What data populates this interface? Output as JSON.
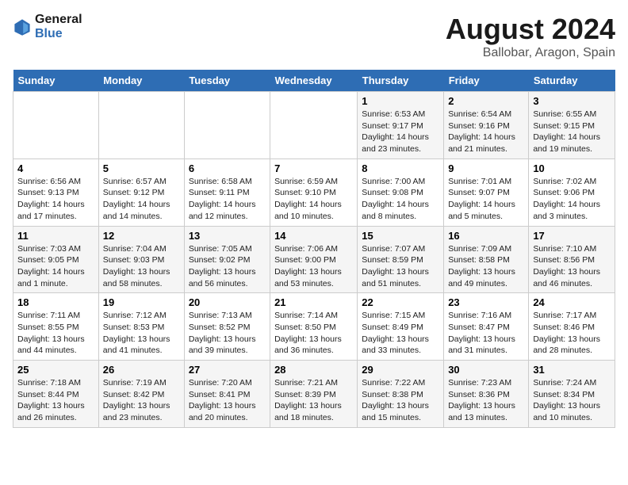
{
  "logo": {
    "line1": "General",
    "line2": "Blue"
  },
  "title": "August 2024",
  "subtitle": "Ballobar, Aragon, Spain",
  "days_of_week": [
    "Sunday",
    "Monday",
    "Tuesday",
    "Wednesday",
    "Thursday",
    "Friday",
    "Saturday"
  ],
  "weeks": [
    [
      {
        "num": "",
        "info": ""
      },
      {
        "num": "",
        "info": ""
      },
      {
        "num": "",
        "info": ""
      },
      {
        "num": "",
        "info": ""
      },
      {
        "num": "1",
        "info": "Sunrise: 6:53 AM\nSunset: 9:17 PM\nDaylight: 14 hours\nand 23 minutes."
      },
      {
        "num": "2",
        "info": "Sunrise: 6:54 AM\nSunset: 9:16 PM\nDaylight: 14 hours\nand 21 minutes."
      },
      {
        "num": "3",
        "info": "Sunrise: 6:55 AM\nSunset: 9:15 PM\nDaylight: 14 hours\nand 19 minutes."
      }
    ],
    [
      {
        "num": "4",
        "info": "Sunrise: 6:56 AM\nSunset: 9:13 PM\nDaylight: 14 hours\nand 17 minutes."
      },
      {
        "num": "5",
        "info": "Sunrise: 6:57 AM\nSunset: 9:12 PM\nDaylight: 14 hours\nand 14 minutes."
      },
      {
        "num": "6",
        "info": "Sunrise: 6:58 AM\nSunset: 9:11 PM\nDaylight: 14 hours\nand 12 minutes."
      },
      {
        "num": "7",
        "info": "Sunrise: 6:59 AM\nSunset: 9:10 PM\nDaylight: 14 hours\nand 10 minutes."
      },
      {
        "num": "8",
        "info": "Sunrise: 7:00 AM\nSunset: 9:08 PM\nDaylight: 14 hours\nand 8 minutes."
      },
      {
        "num": "9",
        "info": "Sunrise: 7:01 AM\nSunset: 9:07 PM\nDaylight: 14 hours\nand 5 minutes."
      },
      {
        "num": "10",
        "info": "Sunrise: 7:02 AM\nSunset: 9:06 PM\nDaylight: 14 hours\nand 3 minutes."
      }
    ],
    [
      {
        "num": "11",
        "info": "Sunrise: 7:03 AM\nSunset: 9:05 PM\nDaylight: 14 hours\nand 1 minute."
      },
      {
        "num": "12",
        "info": "Sunrise: 7:04 AM\nSunset: 9:03 PM\nDaylight: 13 hours\nand 58 minutes."
      },
      {
        "num": "13",
        "info": "Sunrise: 7:05 AM\nSunset: 9:02 PM\nDaylight: 13 hours\nand 56 minutes."
      },
      {
        "num": "14",
        "info": "Sunrise: 7:06 AM\nSunset: 9:00 PM\nDaylight: 13 hours\nand 53 minutes."
      },
      {
        "num": "15",
        "info": "Sunrise: 7:07 AM\nSunset: 8:59 PM\nDaylight: 13 hours\nand 51 minutes."
      },
      {
        "num": "16",
        "info": "Sunrise: 7:09 AM\nSunset: 8:58 PM\nDaylight: 13 hours\nand 49 minutes."
      },
      {
        "num": "17",
        "info": "Sunrise: 7:10 AM\nSunset: 8:56 PM\nDaylight: 13 hours\nand 46 minutes."
      }
    ],
    [
      {
        "num": "18",
        "info": "Sunrise: 7:11 AM\nSunset: 8:55 PM\nDaylight: 13 hours\nand 44 minutes."
      },
      {
        "num": "19",
        "info": "Sunrise: 7:12 AM\nSunset: 8:53 PM\nDaylight: 13 hours\nand 41 minutes."
      },
      {
        "num": "20",
        "info": "Sunrise: 7:13 AM\nSunset: 8:52 PM\nDaylight: 13 hours\nand 39 minutes."
      },
      {
        "num": "21",
        "info": "Sunrise: 7:14 AM\nSunset: 8:50 PM\nDaylight: 13 hours\nand 36 minutes."
      },
      {
        "num": "22",
        "info": "Sunrise: 7:15 AM\nSunset: 8:49 PM\nDaylight: 13 hours\nand 33 minutes."
      },
      {
        "num": "23",
        "info": "Sunrise: 7:16 AM\nSunset: 8:47 PM\nDaylight: 13 hours\nand 31 minutes."
      },
      {
        "num": "24",
        "info": "Sunrise: 7:17 AM\nSunset: 8:46 PM\nDaylight: 13 hours\nand 28 minutes."
      }
    ],
    [
      {
        "num": "25",
        "info": "Sunrise: 7:18 AM\nSunset: 8:44 PM\nDaylight: 13 hours\nand 26 minutes."
      },
      {
        "num": "26",
        "info": "Sunrise: 7:19 AM\nSunset: 8:42 PM\nDaylight: 13 hours\nand 23 minutes."
      },
      {
        "num": "27",
        "info": "Sunrise: 7:20 AM\nSunset: 8:41 PM\nDaylight: 13 hours\nand 20 minutes."
      },
      {
        "num": "28",
        "info": "Sunrise: 7:21 AM\nSunset: 8:39 PM\nDaylight: 13 hours\nand 18 minutes."
      },
      {
        "num": "29",
        "info": "Sunrise: 7:22 AM\nSunset: 8:38 PM\nDaylight: 13 hours\nand 15 minutes."
      },
      {
        "num": "30",
        "info": "Sunrise: 7:23 AM\nSunset: 8:36 PM\nDaylight: 13 hours\nand 13 minutes."
      },
      {
        "num": "31",
        "info": "Sunrise: 7:24 AM\nSunset: 8:34 PM\nDaylight: 13 hours\nand 10 minutes."
      }
    ]
  ]
}
